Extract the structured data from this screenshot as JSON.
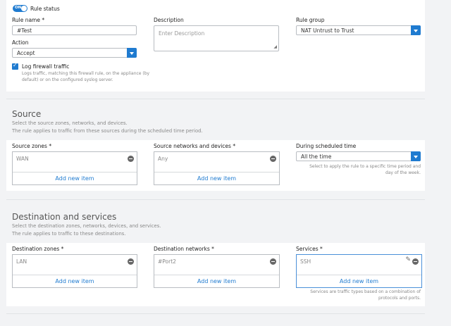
{
  "rule_status": {
    "toggle": "ON",
    "label": "Rule status"
  },
  "rule_name": {
    "label": "Rule name *",
    "value": "#Test"
  },
  "description": {
    "label": "Description",
    "placeholder": "Enter Description"
  },
  "rule_group": {
    "label": "Rule group",
    "value": "NAT Untrust to Trust"
  },
  "action": {
    "label": "Action",
    "value": "Accept"
  },
  "log": {
    "label": "Log firewall traffic",
    "hint_line1": "Logs traffic, matching this firewall rule, on the appliance (by",
    "hint_line2": "default) or on the configured syslog server."
  },
  "source": {
    "title": "Source",
    "sub1": "Select the source zones, networks, and devices.",
    "sub2": "The rule applies to traffic from these sources during the scheduled time period.",
    "zones": {
      "label": "Source zones *",
      "value": "WAN",
      "add": "Add new item"
    },
    "networks": {
      "label": "Source networks and devices *",
      "value": "Any",
      "add": "Add new item"
    },
    "schedule": {
      "label": "During scheduled time",
      "value": "All the time",
      "hint_line1": "Select to apply the rule to a specific time period and",
      "hint_line2": "day of the week."
    }
  },
  "destination": {
    "title": "Destination and services",
    "sub1": "Select the destination zones, networks, devices, and services.",
    "sub2": "The rule applies to traffic to these destinations.",
    "zones": {
      "label": "Destination zones *",
      "value": "LAN",
      "add": "Add new item"
    },
    "networks": {
      "label": "Destination networks *",
      "value": "#Port2",
      "add": "Add new item"
    },
    "services": {
      "label": "Services *",
      "value": "SSH",
      "add": "Add new item",
      "hint_line1": "Services are traffic types based on a combination of",
      "hint_line2": "protocols and ports."
    }
  },
  "colors": {
    "accent": "#1f7bd0",
    "toggle": "#1f7bd0"
  }
}
